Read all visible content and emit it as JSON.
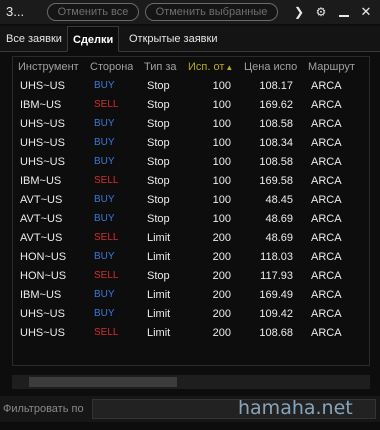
{
  "titlebar": {
    "title": "3...",
    "cancel_all_label": "Отменить все",
    "cancel_selected_label": "Отменить выбранные",
    "icons": [
      "chevron-right-icon",
      "gear-icon",
      "minimize-icon",
      "close-icon"
    ]
  },
  "tabs": [
    {
      "label": "Все заявки",
      "active": false
    },
    {
      "label": "Сделки",
      "active": true
    },
    {
      "label": "Открытые заявки",
      "active": false
    }
  ],
  "table": {
    "columns": [
      "Инструмент",
      "Сторона",
      "Тип за",
      "Исп. от",
      "Цена испо",
      "Маршрут"
    ],
    "sorted_column": 3,
    "sort_direction": "ascending",
    "rows": [
      {
        "symbol": "UHS~US",
        "side": "BUY",
        "type": "Stop",
        "qty": "100",
        "price": "108.17",
        "route": "ARCA"
      },
      {
        "symbol": "IBM~US",
        "side": "SELL",
        "type": "Stop",
        "qty": "100",
        "price": "169.62",
        "route": "ARCA"
      },
      {
        "symbol": "UHS~US",
        "side": "BUY",
        "type": "Stop",
        "qty": "100",
        "price": "108.58",
        "route": "ARCA"
      },
      {
        "symbol": "UHS~US",
        "side": "BUY",
        "type": "Stop",
        "qty": "100",
        "price": "108.34",
        "route": "ARCA"
      },
      {
        "symbol": "UHS~US",
        "side": "BUY",
        "type": "Stop",
        "qty": "100",
        "price": "108.58",
        "route": "ARCA"
      },
      {
        "symbol": "IBM~US",
        "side": "SELL",
        "type": "Stop",
        "qty": "100",
        "price": "169.58",
        "route": "ARCA"
      },
      {
        "symbol": "AVT~US",
        "side": "BUY",
        "type": "Stop",
        "qty": "100",
        "price": "48.45",
        "route": "ARCA"
      },
      {
        "symbol": "AVT~US",
        "side": "BUY",
        "type": "Stop",
        "qty": "100",
        "price": "48.69",
        "route": "ARCA"
      },
      {
        "symbol": "AVT~US",
        "side": "SELL",
        "type": "Limit",
        "qty": "200",
        "price": "48.69",
        "route": "ARCA"
      },
      {
        "symbol": "HON~US",
        "side": "BUY",
        "type": "Limit",
        "qty": "200",
        "price": "118.03",
        "route": "ARCA"
      },
      {
        "symbol": "HON~US",
        "side": "SELL",
        "type": "Stop",
        "qty": "200",
        "price": "117.93",
        "route": "ARCA"
      },
      {
        "symbol": "IBM~US",
        "side": "BUY",
        "type": "Limit",
        "qty": "200",
        "price": "169.49",
        "route": "ARCA"
      },
      {
        "symbol": "UHS~US",
        "side": "BUY",
        "type": "Limit",
        "qty": "200",
        "price": "109.42",
        "route": "ARCA"
      },
      {
        "symbol": "UHS~US",
        "side": "SELL",
        "type": "Limit",
        "qty": "200",
        "price": "108.68",
        "route": "ARCA"
      }
    ]
  },
  "filter": {
    "label": "Фильтровать по",
    "value": "",
    "placeholder": ""
  },
  "watermark": "hamaha.net",
  "colors": {
    "buy": "#3b78d8",
    "sell": "#d02e2e",
    "sorted_header": "#b5a82a",
    "background": "#0d0d0d"
  }
}
